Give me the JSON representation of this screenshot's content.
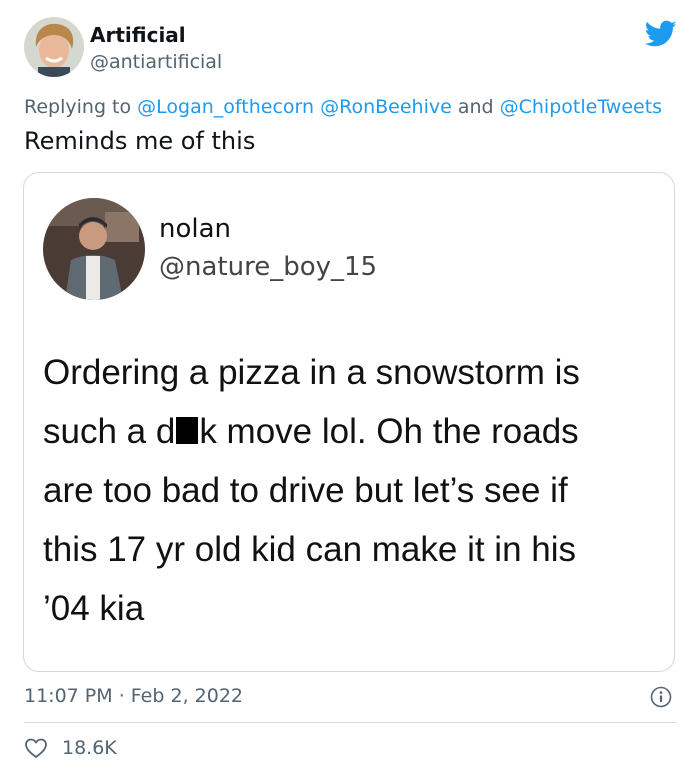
{
  "author": {
    "name": "Artificial",
    "handle": "@antiartificial"
  },
  "icons": {
    "brand": "twitter-bird-icon",
    "info": "info-icon",
    "like": "heart-icon"
  },
  "colors": {
    "accent": "#1d9bf0",
    "muted": "#536471",
    "border": "#cfd9de"
  },
  "reply": {
    "prefix": "Replying to",
    "mention_1": "@Logan_ofthecorn",
    "mention_2": "@RonBeehive",
    "conjunction": "and",
    "mention_3": "@ChipotleTweets"
  },
  "tweet": {
    "text": "Reminds me of this"
  },
  "quote": {
    "name": "nolan",
    "handle": "@nature_boy_15",
    "line_1": "Ordering a pizza in a snowstorm is",
    "line_2_before": "such a d",
    "line_2_after": "k move lol. Oh the roads",
    "line_3": "are too bad to drive but let’s see if",
    "line_4": "this 17 yr old kid can make it in his",
    "line_5": "’04 kia"
  },
  "meta": {
    "time": "11:07 PM",
    "separator": "·",
    "date": "Feb 2, 2022"
  },
  "stats": {
    "likes": "18.6K"
  }
}
